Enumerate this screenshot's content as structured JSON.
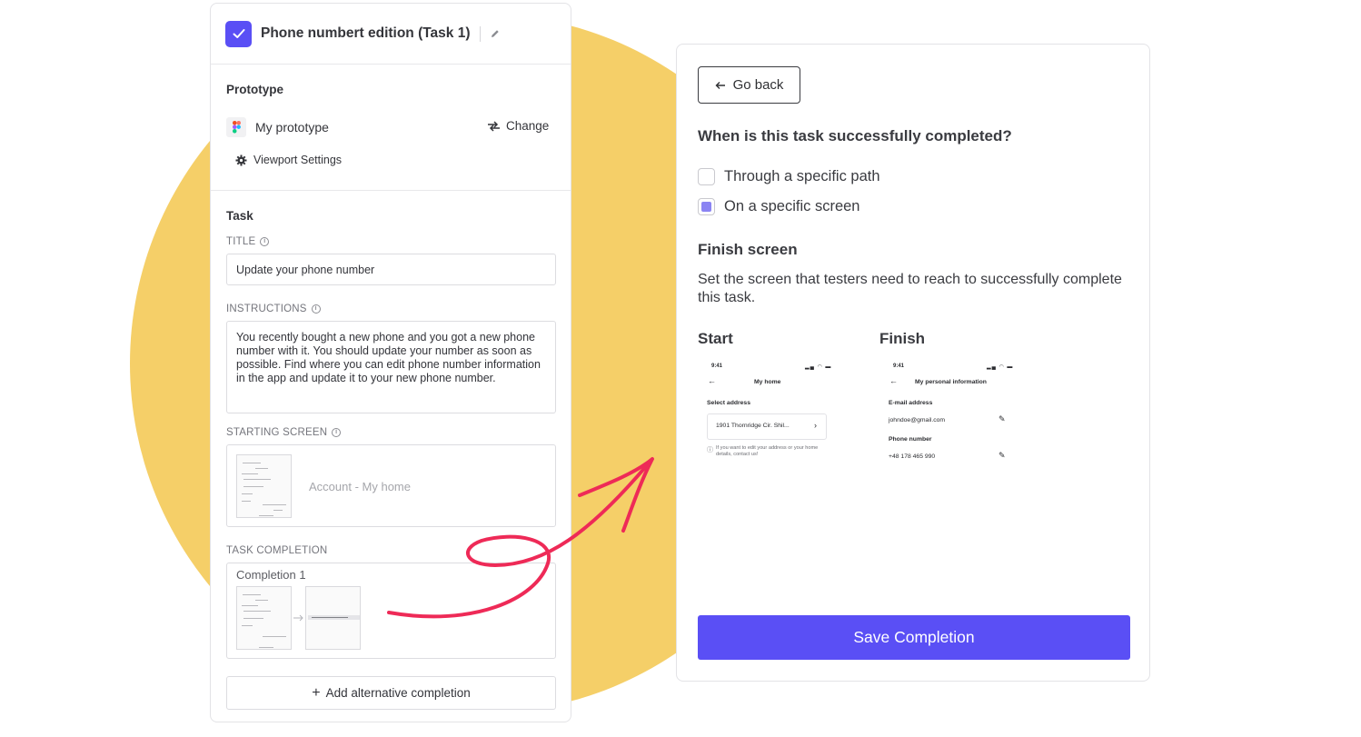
{
  "colors": {
    "accent": "#5a4ff5",
    "decor_circle": "#f5cf68",
    "arrow": "#ee2a57"
  },
  "header": {
    "title": "Phone numbert edition (Task 1)"
  },
  "prototype": {
    "heading": "Prototype",
    "name": "My prototype",
    "change_label": "Change",
    "viewport_label": "Viewport Settings"
  },
  "task": {
    "heading": "Task",
    "title_label": "TITLE",
    "title_value": "Update your phone number",
    "instructions_label": "INSTRUCTIONS",
    "instructions_value": "You recently bought a new phone and you got a new phone number with it. You should update your number as soon as possible. Find where you can edit phone number information in the app and update it to your new phone number.",
    "starting_screen_label": "STARTING SCREEN",
    "starting_screen_value": "Account - My home",
    "completion_label": "TASK COMPLETION",
    "completion_name": "Completion 1",
    "add_alt_label": "Add alternative completion"
  },
  "right": {
    "go_back": "Go back",
    "question": "When is this task successfully completed?",
    "options": [
      {
        "label": "Through a specific path",
        "selected": false
      },
      {
        "label": "On a specific screen",
        "selected": true
      }
    ],
    "finish_heading": "Finish screen",
    "finish_desc": "Set the screen that testers need to reach to successfully complete this task.",
    "start_label": "Start",
    "finish_label": "Finish",
    "start_screen": {
      "time": "9:41",
      "title": "My home",
      "section": "Select address",
      "address": "1901 Thornridge Cir. Shil...",
      "note": "If you want to edit your address or your home details, contact us!"
    },
    "finish_screen": {
      "time": "9:41",
      "title": "My personal information",
      "email_label": "E-mail address",
      "email_value": "johndoe@gmail.com",
      "phone_label": "Phone number",
      "phone_value": "+48 178 465 990"
    },
    "save_label": "Save Completion"
  }
}
